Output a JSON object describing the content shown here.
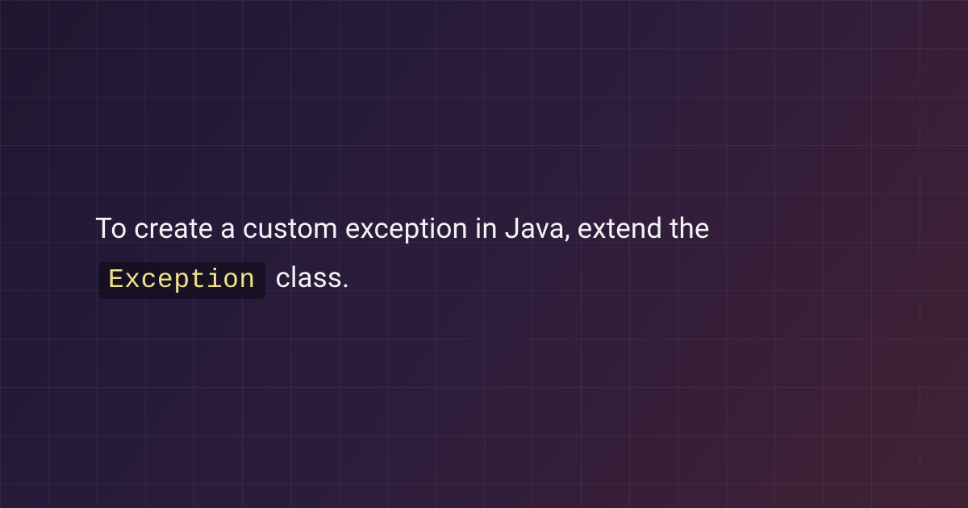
{
  "content": {
    "text_before": "To create a custom exception in Java, extend the ",
    "code_token": "Exception",
    "text_after": " class."
  }
}
